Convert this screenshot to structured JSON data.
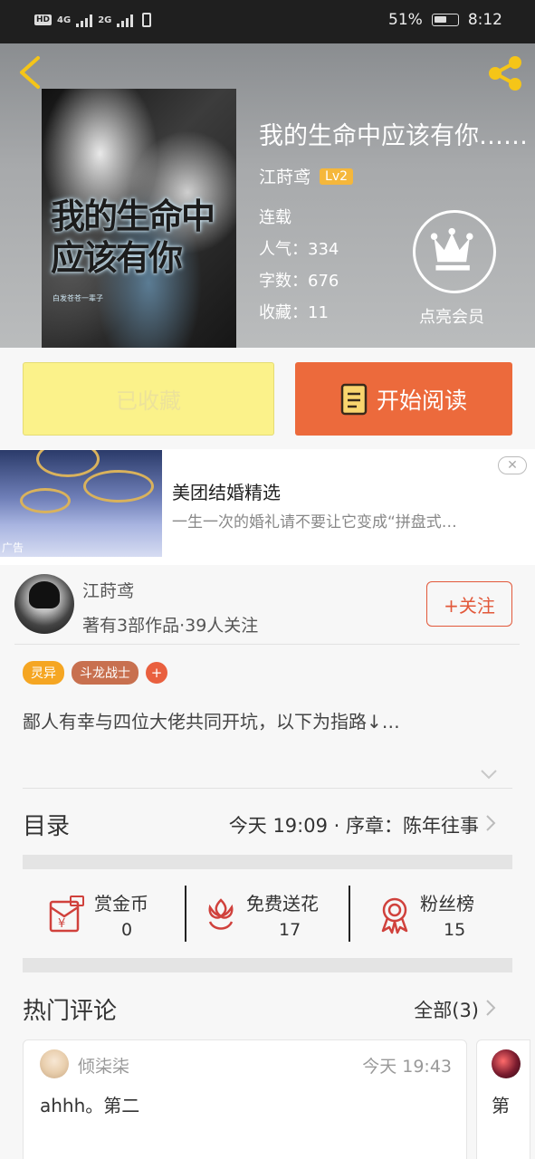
{
  "status_bar": {
    "battery_pct": "51%",
    "time": "8:12",
    "net1": "4G",
    "net2": "2G"
  },
  "book": {
    "title": "我的生命中应该有你……",
    "author": "江莳鸢",
    "level": "Lv2",
    "status": "连载",
    "popularity": "人气：334",
    "word_count": "字数：676",
    "favorites": "收藏：11",
    "member_label": "点亮会员",
    "cover_text": "我的生命中应该有你",
    "cover_sub": "白发苍苍一辈子"
  },
  "actions": {
    "collected": "已收藏",
    "read": "开始阅读"
  },
  "ad": {
    "title": "美团结婚精选",
    "desc": "一生一次的婚礼请不要让它变成“拼盘式…",
    "tag": "广告",
    "close": "✕"
  },
  "author_card": {
    "name": "江莳鸢",
    "stats": "著有3部作品·39人关注",
    "follow": "+关注"
  },
  "tags": [
    "灵异",
    "斗龙战士"
  ],
  "tag_plus": "+",
  "intro": "鄙人有幸与四位大佬共同开坑，以下为指路↓…",
  "toc": {
    "label": "目录",
    "latest": "今天 19:09 · 序章：陈年往事"
  },
  "stats": [
    {
      "label": "赏金币",
      "value": "0"
    },
    {
      "label": "免费送花",
      "value": "17"
    },
    {
      "label": "粉丝榜",
      "value": "15"
    }
  ],
  "comments": {
    "title": "热门评论",
    "all": "全部(3)",
    "items": [
      {
        "user": "倾柒柒",
        "time": "今天 19:43",
        "text": "ahhh。第二"
      },
      {
        "text": "第"
      }
    ]
  },
  "colors": {
    "accent": "#ec6a3c",
    "collected_bg": "#fbf28a",
    "tag1": "#f5a623",
    "tag2": "#c8704f"
  }
}
